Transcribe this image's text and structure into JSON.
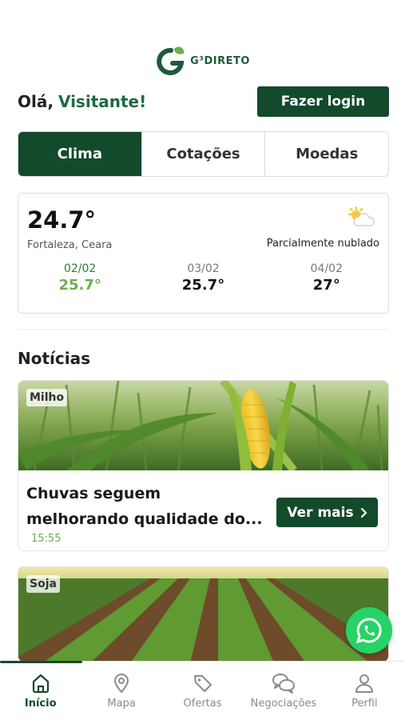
{
  "brand": {
    "name": "G³DIRETO",
    "icon": "g3-leaf-logo"
  },
  "greeting": {
    "hello": "Olá,",
    "visitor": "Visitante!"
  },
  "login_button": "Fazer login",
  "tabs": [
    {
      "label": "Clima",
      "active": true
    },
    {
      "label": "Cotações",
      "active": false
    },
    {
      "label": "Moedas",
      "active": false
    }
  ],
  "weather": {
    "current_temp": "24.7°",
    "location": "Fortaleza, Ceara",
    "condition": "Parcialmente nublado",
    "icon": "partly-cloudy-icon",
    "forecast": [
      {
        "date": "02/02",
        "temp": "25.7°"
      },
      {
        "date": "03/02",
        "temp": "25.7°"
      },
      {
        "date": "04/02",
        "temp": "27°"
      }
    ]
  },
  "news_section_title": "Notícias",
  "news": [
    {
      "tag": "Milho",
      "headline_line1": "Chuvas seguem",
      "headline_line2": "melhorando qualidade do...",
      "time": "15:55",
      "button": "Ver mais",
      "image": "corn-field"
    },
    {
      "tag": "Soja",
      "image": "soybean-field"
    }
  ],
  "whatsapp_icon": "whatsapp-icon",
  "bottom_nav": [
    {
      "label": "Início",
      "icon": "home-icon",
      "active": true
    },
    {
      "label": "Mapa",
      "icon": "map-pin-icon",
      "active": false
    },
    {
      "label": "Ofertas",
      "icon": "tag-icon",
      "active": false
    },
    {
      "label": "Negociações",
      "icon": "chat-icon",
      "active": false
    },
    {
      "label": "Perfil",
      "icon": "user-icon",
      "active": false
    }
  ],
  "colors": {
    "primary": "#134a2c",
    "accent_green": "#6ab04c",
    "whatsapp": "#25d366"
  }
}
